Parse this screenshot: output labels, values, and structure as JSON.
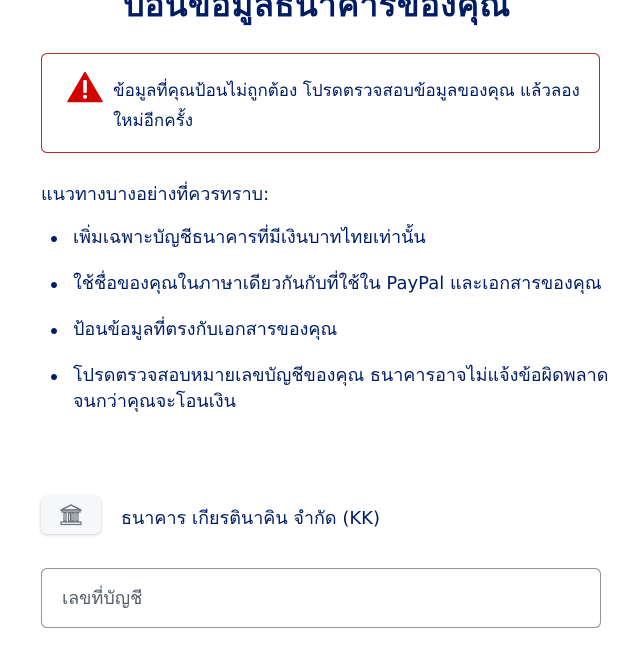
{
  "page": {
    "title": "ป้อนข้อมูลธนาคารของคุณ"
  },
  "error": {
    "icon": "warning-triangle-icon",
    "icon_color": "#d20000",
    "border_color": "#c0262f",
    "message": "ข้อมูลที่คุณป้อนไม่ถูกต้อง โปรดตรวจสอบข้อมูลของคุณ แล้วลองใหม่อีกครั้ง"
  },
  "guidelines": {
    "heading": "แนวทางบางอย่างที่ควรทราบ:",
    "items": [
      "เพิ่มเฉพาะบัญชีธนาคารที่มีเงินบาทไทยเท่านั้น",
      "ใช้ชื่อของคุณในภาษาเดียวกันกับที่ใช้ใน PayPal และเอกสารของคุณ",
      "ป้อนข้อมูลที่ตรงกับเอกสารของคุณ",
      "โปรดตรวจสอบหมายเลขบัญชีของคุณ ธนาคารอาจไม่แจ้งข้อผิดพลาดจนกว่าคุณจะโอนเงิน"
    ]
  },
  "bank": {
    "icon": "bank-building-icon",
    "name": "ธนาคาร เกียรตินาคิน จำกัด (KK)"
  },
  "account_number": {
    "placeholder": "เลขที่บัญชี",
    "value": ""
  },
  "colors": {
    "text": "#001c64",
    "border": "#929496"
  }
}
